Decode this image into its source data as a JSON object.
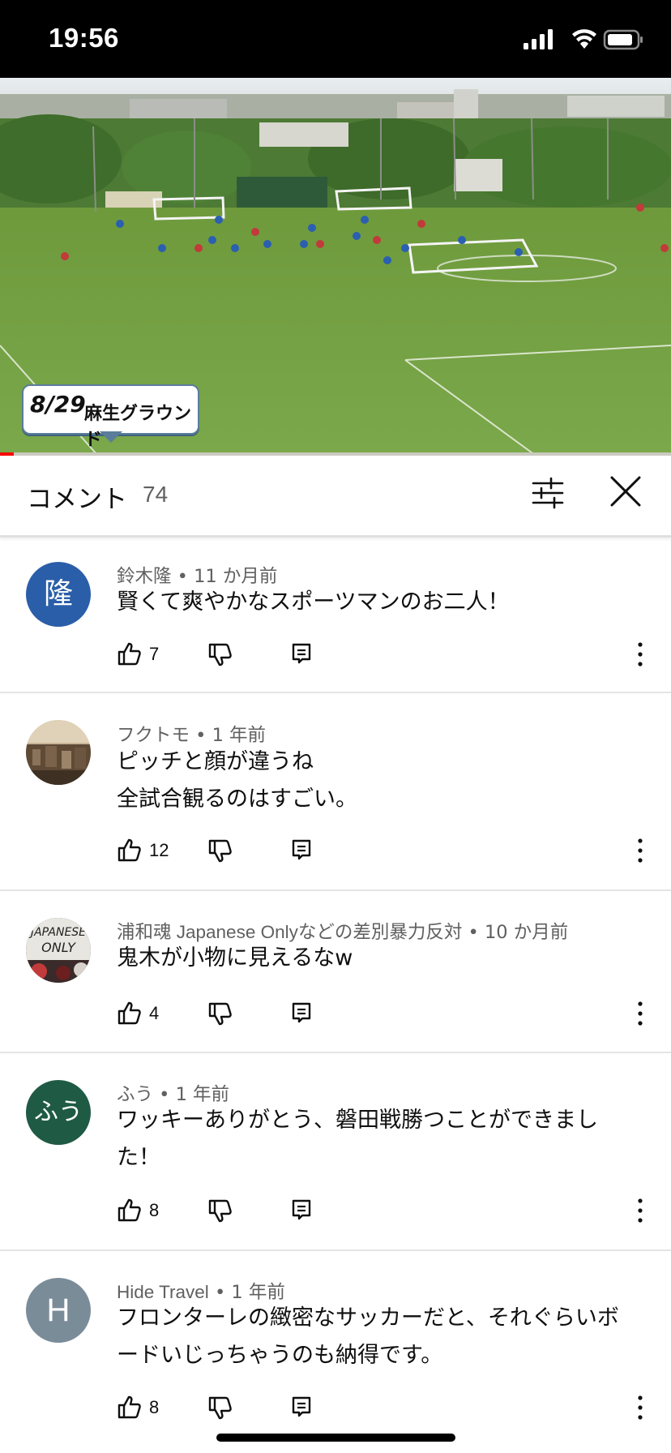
{
  "status_bar": {
    "time": "19:56"
  },
  "video": {
    "overlay_date": "8/29",
    "overlay_place": "麻生グラウンド",
    "progress_fraction": 0.02
  },
  "comments_header": {
    "title": "コメント",
    "count": "74"
  },
  "comments": [
    {
      "author": "鈴木隆",
      "time": "11 か月前",
      "text_lines": [
        "賢くて爽やかなスポーツマンのお二人！"
      ],
      "likes": "7",
      "avatar": {
        "type": "initial",
        "letter": "隆",
        "color": "#2a5ea8"
      }
    },
    {
      "author": "フクトモ",
      "time": "1 年前",
      "text_lines": [
        "ピッチと顔が違うね",
        "全試合観るのはすごい。"
      ],
      "likes": "12",
      "avatar": {
        "type": "photo",
        "name": "city-photo-avatar"
      }
    },
    {
      "author": "浦和魂 Japanese Onlyなどの差別暴力反対",
      "time": "10 か月前",
      "text_lines": [
        "鬼木が小物に見えるなw"
      ],
      "likes": "4",
      "avatar": {
        "type": "photo",
        "name": "banner-photo-avatar",
        "letters": "JAPANESE ONLY"
      }
    },
    {
      "author": "ふう",
      "time": "1 年前",
      "text_lines": [
        "ワッキーありがとう、磐田戦勝つことができまし",
        "た！"
      ],
      "likes": "8",
      "avatar": {
        "type": "initial",
        "letter": "ふう",
        "color": "#1f5a45"
      }
    },
    {
      "author": "Hide Travel",
      "time": "1 年前",
      "text_lines": [
        "フロンターレの緻密なサッカーだと、それぐらいボ",
        "ードいじっちゃうのも納得です。"
      ],
      "likes": "8",
      "avatar": {
        "type": "initial",
        "letter": "H",
        "color": "#7b8c99"
      }
    }
  ],
  "separator": " • "
}
